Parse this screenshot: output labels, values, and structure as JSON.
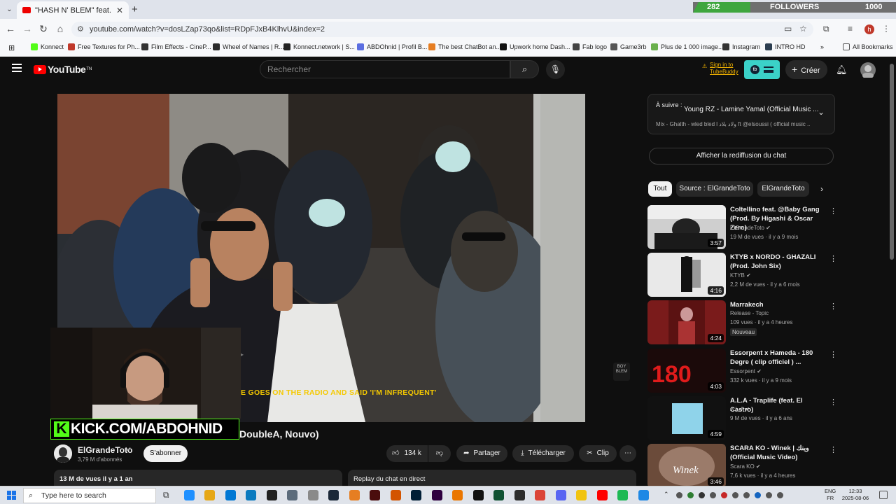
{
  "browser": {
    "tab_title": "\"HASH N' BLEM\" feat. @un",
    "new_tab": "+",
    "url": "youtube.com/watch?v=dosLZap73qo&list=RDpFJxB4KlhvU&index=2",
    "bookmarks": [
      {
        "label": "Konnect",
        "color": "#53fc18"
      },
      {
        "label": "Free Textures for Ph...",
        "color": "#c0392b"
      },
      {
        "label": "Film Effects - CineP...",
        "color": "#333333"
      },
      {
        "label": "Wheel of Names | R...",
        "color": "#2b2b2b"
      },
      {
        "label": "Konnect.network | S...",
        "color": "#222222"
      },
      {
        "label": "ABDOhnid | Profil B...",
        "color": "#5b6ee1"
      },
      {
        "label": "The best ChatBot an...",
        "color": "#e67e22"
      },
      {
        "label": "Upwork home Dash...",
        "color": "#111111"
      },
      {
        "label": "Fab logo",
        "color": "#444444"
      },
      {
        "label": "Game3rb",
        "color": "#555555"
      },
      {
        "label": "Plus de 1 000 image...",
        "color": "#6ab04c"
      },
      {
        "label": "Instagram",
        "color": "#333333"
      },
      {
        "label": "INTRO HD",
        "color": "#2c3e50"
      }
    ],
    "all_bookmarks": "All Bookmarks",
    "profile_initial": "h"
  },
  "overlay": {
    "followers_label": "FOLLOWERS",
    "followers_current": "282",
    "followers_goal": "1000",
    "followers_progress": 0.282,
    "kick_logo": "K",
    "kick_url": "KICK.COM/ABDOHNID"
  },
  "youtube": {
    "logo": "YouTube",
    "logo_tn": "TN",
    "search_placeholder": "Rechercher",
    "tubebuddy": "Sign in to TubeBuddy",
    "tubebuddy_badge": "tb",
    "create_label": "Créer",
    "video_subtitle": "E GOES ON THE RADIO AND SAID 'I'M INFREQUENT'",
    "video_watermark": "BOY\nBLEM",
    "video_title_visible": "DoubleA, Nouvo)",
    "channel": "ElGrandeToto",
    "subscribers": "3,79 M d'abonnés",
    "subscribe": "S'abonner",
    "likes": "134 k",
    "share": "Partager",
    "download": "Télécharger",
    "clip": "Clip",
    "views_time": "13 M de vues  il y a 1 an",
    "replay_label": "Replay du chat en direct",
    "up_next_label": "À suivre :",
    "up_next_title": "Young RZ - Lamine Yamal (Official Music ...",
    "up_next_sub": "Mix - Ghalth - wled bled l ولاد بلاد ft @elsoussi ( official music ...",
    "chat_replay": "Afficher la rediffusion du chat",
    "chips": [
      "Tout",
      "Source : ElGrandeToto",
      "ElGrandeToto"
    ],
    "recommendations": [
      {
        "title": "Coltellino feat. @Baby Gang (Prod. By Higashi & Oscar Zero)",
        "channel": "ElGrandeToto",
        "verified": true,
        "meta": "19 M de vues · il y a 9 mois",
        "duration": "3:57",
        "badge": ""
      },
      {
        "title": "KTYB x NORDO - GHAZALI (Prod. John Six)",
        "channel": "KTYB",
        "verified": true,
        "meta": "2,2 M de vues · il y a 6 mois",
        "duration": "4:16",
        "badge": ""
      },
      {
        "title": "Marrakech",
        "channel": "Release - Topic",
        "verified": false,
        "meta": "109 vues · il y a 4 heures",
        "duration": "4:24",
        "badge": "Nouveau"
      },
      {
        "title": "Essorpent x Hameda - 180 Degre ( clip officiel ) ...",
        "channel": "Essorpent",
        "verified": true,
        "meta": "332 k vues · il y a 9 mois",
        "duration": "4:03",
        "badge": ""
      },
      {
        "title": "A.L.A - Traplife (feat. El Castro)",
        "channel": "A.L.A",
        "verified": true,
        "meta": "9 M de vues · il y a 6 ans",
        "duration": "4:59",
        "badge": ""
      },
      {
        "title": "SCARA KO - Winek | وينك (Official Music Video)",
        "channel": "Scara KO",
        "verified": true,
        "meta": "7,6 k vues · il y a 4 heures",
        "duration": "3:46",
        "badge": ""
      }
    ]
  },
  "taskbar": {
    "search": "Type here to search",
    "lang": "ENG",
    "region": "FR",
    "time": "12:33",
    "date": "2025-08-06",
    "apps": [
      "#6a5acd",
      "#1e90ff",
      "#e6a817",
      "#0078d4",
      "#0a7abf",
      "#222222",
      "#5b6b7b",
      "#8a8a8a",
      "#1b2838",
      "#e67e22",
      "#4a0d0d",
      "#d35400",
      "#001e36",
      "#2e0040",
      "#ea7600",
      "#111111",
      "#0f5132",
      "#2c2c2c",
      "#db4437",
      "#5865f2",
      "#f1c40f",
      "#ff0000",
      "#1db954",
      "#1e88e5"
    ]
  }
}
